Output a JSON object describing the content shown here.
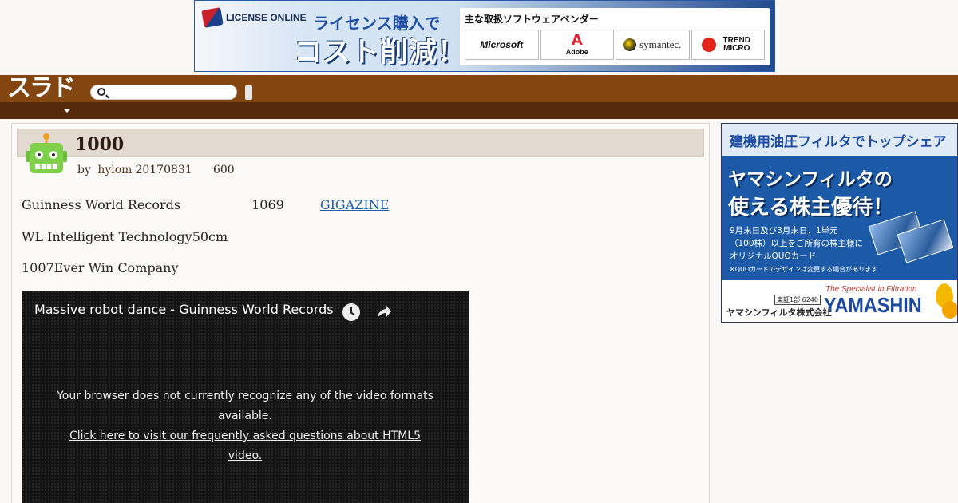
{
  "top_ad": {
    "logo_text": "LICENSE ONLINE",
    "line1": "ライセンス購入で",
    "line2": "コスト削減！",
    "vendor_title": "主な取扱ソフトウェアベンダー",
    "vendors": [
      "Microsoft",
      "Adobe",
      "symantec.",
      "TREND MICRO"
    ],
    "adobe_glyph": "A"
  },
  "header": {
    "logo": "スラド",
    "search_placeholder": ""
  },
  "article": {
    "title": "1000",
    "byline": {
      "by": "by",
      "author": "hylom",
      "date": "20170831",
      "count": "600"
    },
    "para1": {
      "text_a": "Guinness World Records",
      "text_b": "1069",
      "link": "GIGAZINE"
    },
    "para2": "WL Intelligent Technology50cm",
    "para3": "1007Ever Win Company"
  },
  "video": {
    "title": "Massive robot dance - Guinness World Records",
    "message": "Your browser does not currently recognize any of the video formats available.",
    "link": "Click here to visit our frequently asked questions about HTML5 video."
  },
  "side_ad": {
    "headline": "建機用油圧フィルタでトップシェア",
    "big1": "ヤマシンフィルタの",
    "big2": "使える株主優待！",
    "small1": "9月末日及び3月末日、1単元",
    "small2": "（100株）以上をご所有の株主様に",
    "small3": "オリジナルQUOカード",
    "note": "※QUOカードのデザインは変更する場合があります",
    "tagline": "The Specialist in Filtration",
    "brand": "YAMASHIN",
    "stock": "東証1部 6240",
    "company": "ヤマシンフィルタ株式会社"
  },
  "colors": {
    "header_top": "#834611",
    "header_bottom": "#56290a",
    "link": "#1f5fa8",
    "title_bar": "#e3dacf"
  }
}
